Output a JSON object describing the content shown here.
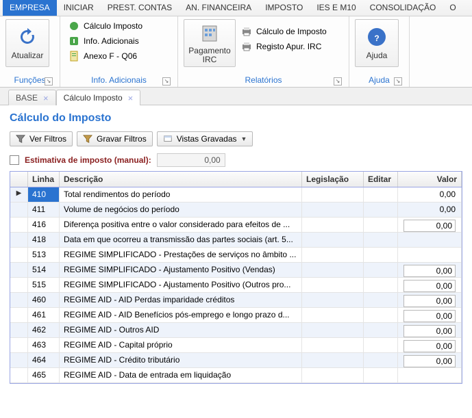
{
  "menu": {
    "items": [
      "EMPRESA",
      "INICIAR",
      "PREST. CONTAS",
      "AN. FINANCEIRA",
      "IMPOSTO",
      "IES E M10",
      "CONSOLIDAÇÃO",
      "O"
    ],
    "active_index": 0
  },
  "ribbon": {
    "groups": [
      {
        "name": "funcoes",
        "footer": "Funções",
        "big": {
          "label": "Atualizar",
          "icon": "refresh"
        }
      },
      {
        "name": "info-adicionais",
        "footer": "Info. Adicionais",
        "items": [
          {
            "icon": "calc-green",
            "label": "Cálculo Imposto"
          },
          {
            "icon": "info-green",
            "label": "Info. Adicionais"
          },
          {
            "icon": "doc-green",
            "label": "Anexo F - Q06"
          }
        ]
      },
      {
        "name": "relatorios",
        "footer": "Relatórios",
        "big": {
          "label": "Pagamento IRC",
          "icon": "building"
        },
        "items": [
          {
            "icon": "printer",
            "label": "Cálculo de Imposto"
          },
          {
            "icon": "printer",
            "label": "Registo Apur. IRC"
          }
        ]
      },
      {
        "name": "ajuda",
        "footer": "Ajuda",
        "big": {
          "label": "Ajuda",
          "icon": "help"
        }
      }
    ]
  },
  "tabs": {
    "items": [
      {
        "label": "BASE"
      },
      {
        "label": "Cálculo Imposto"
      }
    ],
    "active_index": 1
  },
  "page": {
    "title": "Cálculo do Imposto",
    "buttons": {
      "ver_filtros": "Ver Filtros",
      "gravar_filtros": "Gravar Filtros",
      "vistas_gravadas": "Vistas Gravadas"
    },
    "estimativa": {
      "label": "Estimativa de imposto (manual):",
      "value": "0,00"
    }
  },
  "table": {
    "headers": {
      "linha": "Linha",
      "descricao": "Descrição",
      "legislacao": "Legislação",
      "editar": "Editar",
      "valor": "Valor"
    },
    "rows": [
      {
        "selected": true,
        "linha": "410",
        "descricao": "Total rendimentos do período",
        "valor": "0,00",
        "valor_editable": false
      },
      {
        "selected": false,
        "linha": "411",
        "descricao": "Volume de negócios do período",
        "valor": "0,00",
        "valor_editable": false
      },
      {
        "selected": false,
        "linha": "416",
        "descricao": "Diferença positiva entre o valor considerado para efeitos de ...",
        "valor": "0,00",
        "valor_editable": true
      },
      {
        "selected": false,
        "linha": "418",
        "descricao": "Data em que ocorreu a transmissão das partes sociais (art. 5...",
        "valor": "",
        "valor_editable": false
      },
      {
        "selected": false,
        "linha": "513",
        "descricao": "REGIME SIMPLIFICADO - Prestações de serviços no âmbito ...",
        "valor": "",
        "valor_editable": false
      },
      {
        "selected": false,
        "linha": "514",
        "descricao": "REGIME SIMPLIFICADO - Ajustamento Positivo (Vendas)",
        "valor": "0,00",
        "valor_editable": true
      },
      {
        "selected": false,
        "linha": "515",
        "descricao": "REGIME SIMPLIFICADO - Ajustamento Positivo (Outros pro...",
        "valor": "0,00",
        "valor_editable": true
      },
      {
        "selected": false,
        "linha": "460",
        "descricao": "REGIME AID - AID Perdas imparidade créditos",
        "valor": "0,00",
        "valor_editable": true
      },
      {
        "selected": false,
        "linha": "461",
        "descricao": "REGIME AID - AID Benefícios pós-emprego e longo prazo d...",
        "valor": "0,00",
        "valor_editable": true
      },
      {
        "selected": false,
        "linha": "462",
        "descricao": "REGIME AID - Outros AID",
        "valor": "0,00",
        "valor_editable": true
      },
      {
        "selected": false,
        "linha": "463",
        "descricao": "REGIME AID - Capital próprio",
        "valor": "0,00",
        "valor_editable": true
      },
      {
        "selected": false,
        "linha": "464",
        "descricao": "REGIME AID - Crédito tributário",
        "valor": "0,00",
        "valor_editable": true
      },
      {
        "selected": false,
        "linha": "465",
        "descricao": "REGIME AID - Data de entrada em liquidação",
        "valor": "",
        "valor_editable": false
      }
    ]
  }
}
